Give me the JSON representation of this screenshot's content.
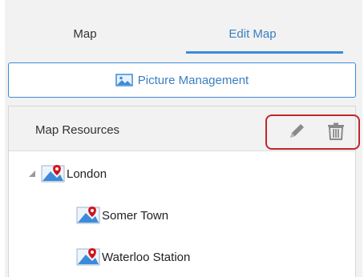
{
  "tabs": [
    {
      "label": "Map"
    },
    {
      "label": "Edit Map",
      "active": true
    }
  ],
  "picture_button": {
    "label": "Picture Management",
    "icon": "picture-icon"
  },
  "resources": {
    "title": "Map Resources",
    "tools": [
      {
        "icon": "pencil-icon",
        "action": "edit"
      },
      {
        "icon": "trash-icon",
        "action": "delete"
      }
    ],
    "tree": [
      {
        "label": "London",
        "expanded": true,
        "children": [
          {
            "label": "Somer Town"
          },
          {
            "label": "Waterloo Station"
          }
        ]
      }
    ]
  },
  "colors": {
    "accent": "#3c8bd9",
    "highlight": "#c0272d",
    "panel_bg": "#f2f2f2",
    "pin": "#d0141c"
  }
}
